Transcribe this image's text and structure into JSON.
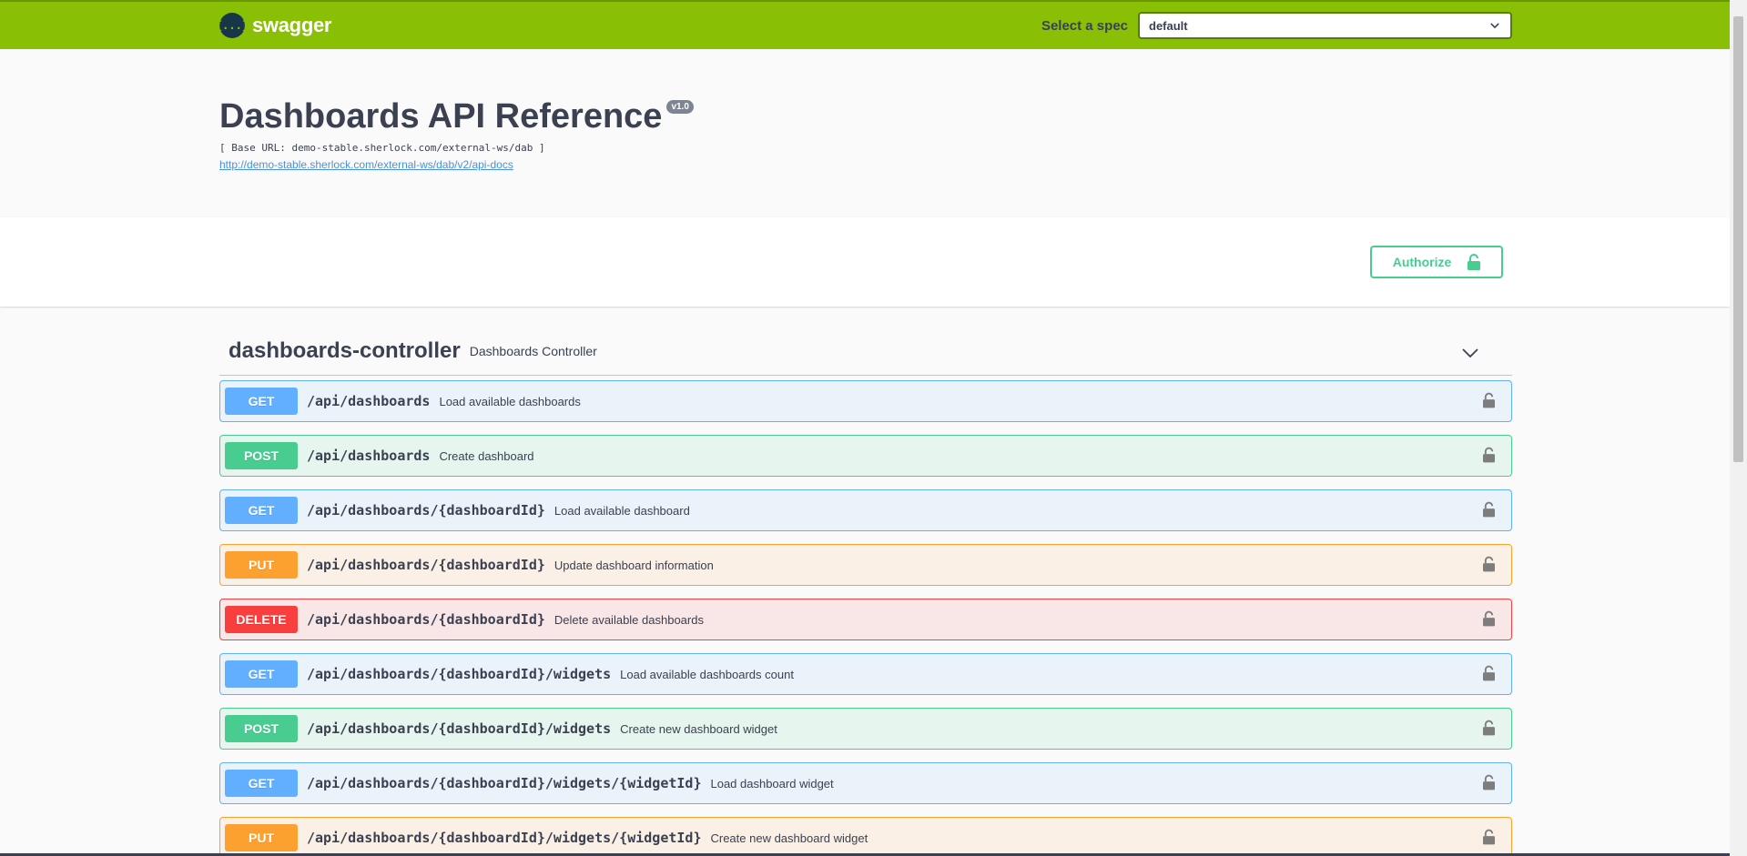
{
  "topbar": {
    "logo_glyph": "{...}",
    "brand": "swagger",
    "spec_label": "Select a spec",
    "spec_selected": "default",
    "bar_color": "#89bf04"
  },
  "info": {
    "title": "Dashboards API Reference",
    "version": "v1.0",
    "base_url": "[ Base URL: demo-stable.sherlock.com/external-ws/dab ]",
    "docs_link": "http://demo-stable.sherlock.com/external-ws/dab/v2/api-docs"
  },
  "scheme": {
    "authorize_label": "Authorize"
  },
  "tag": {
    "name": "dashboards-controller",
    "description": "Dashboards Controller"
  },
  "method_colors": {
    "GET": "#61affe",
    "POST": "#49cc90",
    "PUT": "#fca130",
    "DELETE": "#f93e3e"
  },
  "operations": [
    {
      "method": "GET",
      "path": "/api/dashboards",
      "summary": "Load available dashboards"
    },
    {
      "method": "POST",
      "path": "/api/dashboards",
      "summary": "Create dashboard"
    },
    {
      "method": "GET",
      "path": "/api/dashboards/{dashboardId}",
      "summary": "Load available dashboard"
    },
    {
      "method": "PUT",
      "path": "/api/dashboards/{dashboardId}",
      "summary": "Update dashboard information"
    },
    {
      "method": "DELETE",
      "path": "/api/dashboards/{dashboardId}",
      "summary": "Delete available dashboards"
    },
    {
      "method": "GET",
      "path": "/api/dashboards/{dashboardId}/widgets",
      "summary": "Load available dashboards count"
    },
    {
      "method": "POST",
      "path": "/api/dashboards/{dashboardId}/widgets",
      "summary": "Create new dashboard widget"
    },
    {
      "method": "GET",
      "path": "/api/dashboards/{dashboardId}/widgets/{widgetId}",
      "summary": "Load dashboard widget"
    },
    {
      "method": "PUT",
      "path": "/api/dashboards/{dashboardId}/widgets/{widgetId}",
      "summary": "Create new dashboard widget"
    }
  ]
}
